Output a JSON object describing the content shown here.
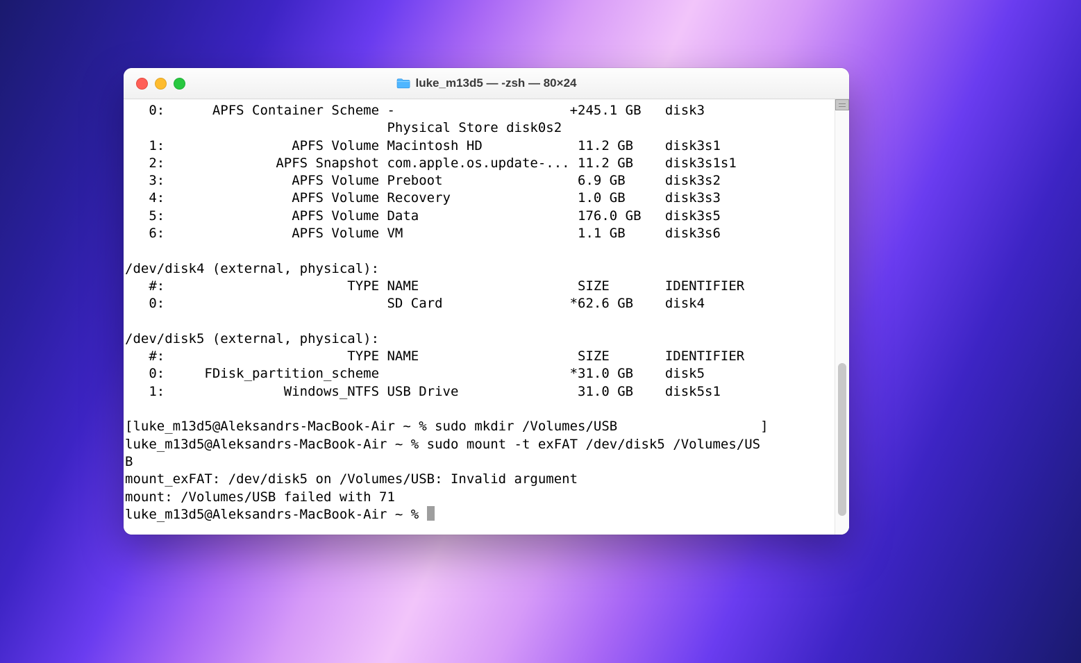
{
  "window": {
    "title": "luke_m13d5 — -zsh — 80×24"
  },
  "terminal": {
    "lines": [
      "   0:      APFS Container Scheme -                      +245.1 GB   disk3",
      "                                 Physical Store disk0s2",
      "   1:                APFS Volume Macintosh HD            11.2 GB    disk3s1",
      "   2:              APFS Snapshot com.apple.os.update-... 11.2 GB    disk3s1s1",
      "   3:                APFS Volume Preboot                 6.9 GB     disk3s2",
      "   4:                APFS Volume Recovery                1.0 GB     disk3s3",
      "   5:                APFS Volume Data                    176.0 GB   disk3s5",
      "   6:                APFS Volume VM                      1.1 GB     disk3s6",
      "",
      "/dev/disk4 (external, physical):",
      "   #:                       TYPE NAME                    SIZE       IDENTIFIER",
      "   0:                            SD Card                *62.6 GB    disk4",
      "",
      "/dev/disk5 (external, physical):",
      "   #:                       TYPE NAME                    SIZE       IDENTIFIER",
      "   0:     FDisk_partition_scheme                        *31.0 GB    disk5",
      "   1:               Windows_NTFS USB Drive               31.0 GB    disk5s1",
      "",
      "[luke_m13d5@Aleksandrs-MacBook-Air ~ % sudo mkdir /Volumes/USB                  ]",
      "luke_m13d5@Aleksandrs-MacBook-Air ~ % sudo mount -t exFAT /dev/disk5 /Volumes/US",
      "B",
      "mount_exFAT: /dev/disk5 on /Volumes/USB: Invalid argument",
      "mount: /Volumes/USB failed with 71",
      "luke_m13d5@Aleksandrs-MacBook-Air ~ % "
    ]
  }
}
